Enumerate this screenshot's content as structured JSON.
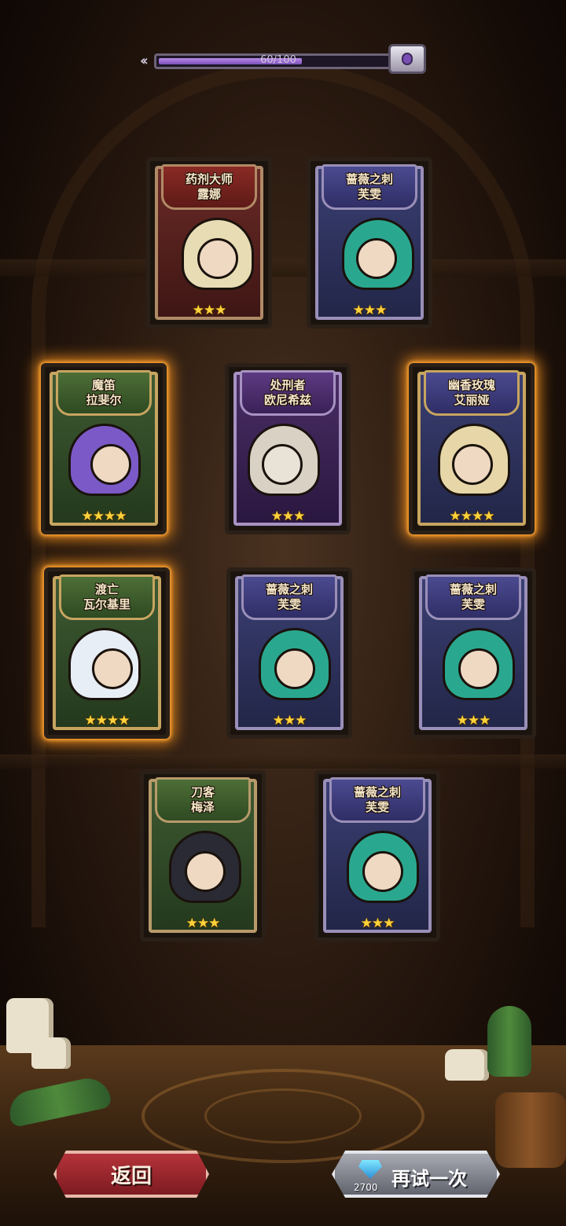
{
  "progress": {
    "label": "60/100",
    "value": 0.6
  },
  "cards": [
    {
      "title": "药剂大师",
      "name": "露娜",
      "stars": "★★★"
    },
    {
      "title": "蔷薇之刺",
      "name": "芙雯",
      "stars": "★★★"
    },
    {
      "title": "魔笛",
      "name": "拉斐尔",
      "stars": "★★★★"
    },
    {
      "title": "处刑者",
      "name": "欧尼希兹",
      "stars": "★★★"
    },
    {
      "title": "幽香玫瑰",
      "name": "艾丽娅",
      "stars": "★★★★"
    },
    {
      "title": "渡亡",
      "name": "瓦尔基里",
      "stars": "★★★★"
    },
    {
      "title": "蔷薇之刺",
      "name": "芙雯",
      "stars": "★★★"
    },
    {
      "title": "蔷薇之刺",
      "name": "芙雯",
      "stars": "★★★"
    },
    {
      "title": "刀客",
      "name": "梅泽",
      "stars": "★★★"
    },
    {
      "title": "蔷薇之刺",
      "name": "芙雯",
      "stars": "★★★"
    }
  ],
  "buttons": {
    "back_label": "返回",
    "retry_label": "再试一次",
    "retry_cost": "2700"
  },
  "colors": {
    "glow": "#ff9a1e",
    "star": "#ffd23a",
    "progress_fill": "#9a6bd3"
  }
}
